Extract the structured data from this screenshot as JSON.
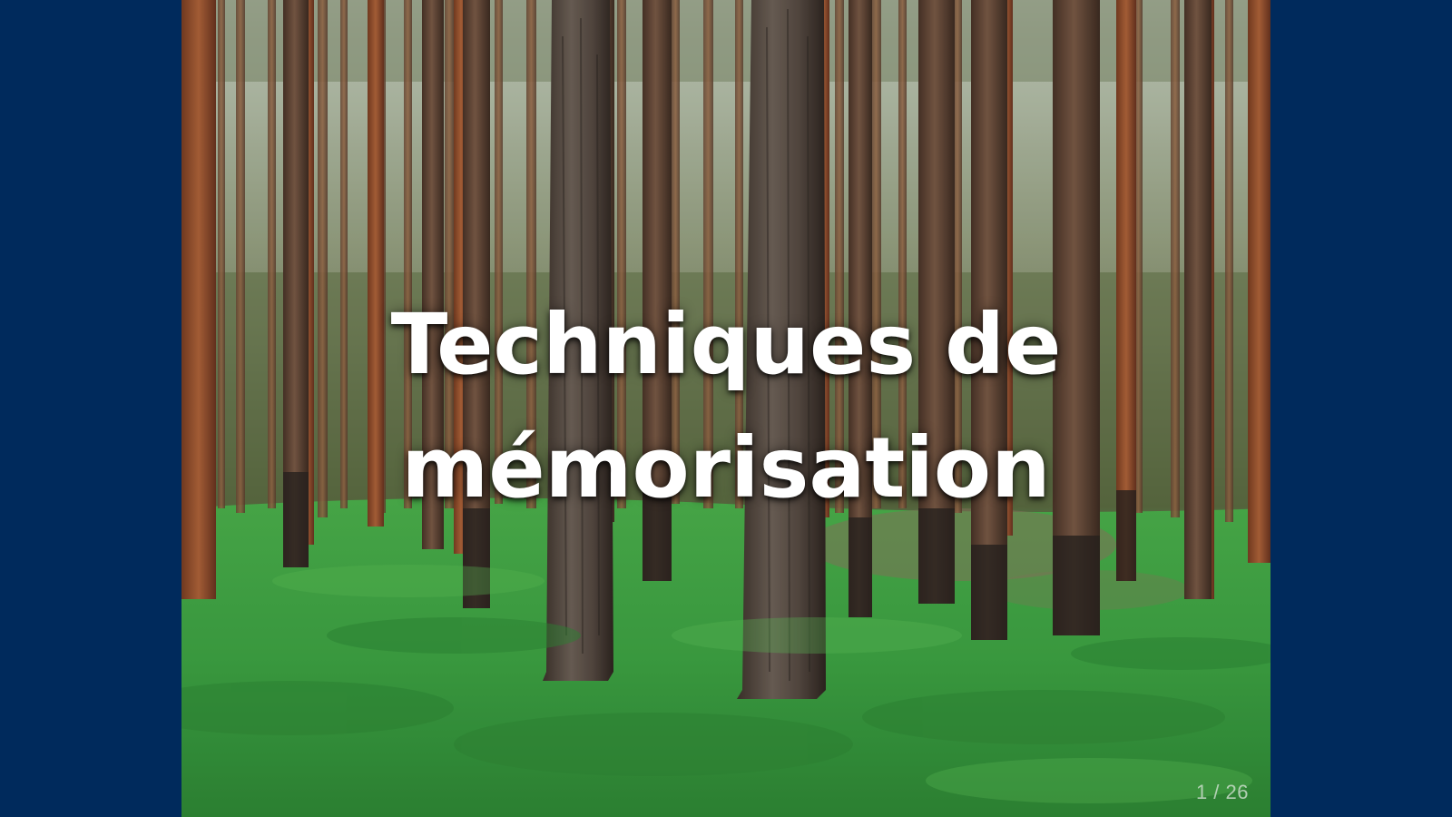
{
  "slide": {
    "title_line1": "Techniques de",
    "title_line2": "mémorisation",
    "counter": "1 / 26"
  },
  "colors": {
    "frame_background": "#002a5c",
    "title_text": "#ffffff",
    "grass": "#3fa845",
    "bark": "#5a3a2a"
  },
  "image": {
    "subject": "pine-forest-photo"
  }
}
